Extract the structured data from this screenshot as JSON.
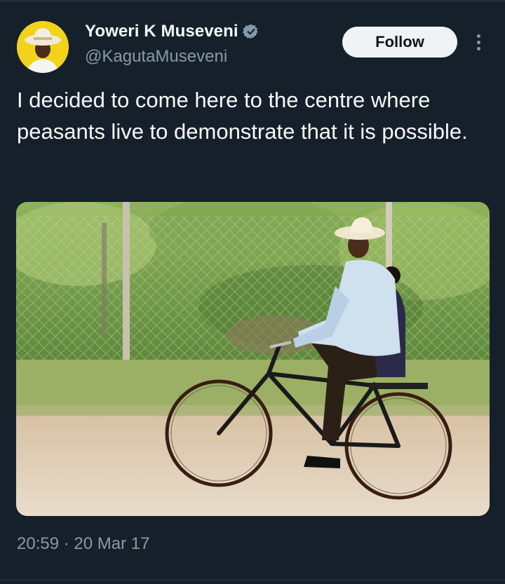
{
  "theme": {
    "background": "#15202b",
    "primary_text": "#f7f9f9",
    "secondary_text": "#8b98a5",
    "verified_badge": "#829aab",
    "follow_button_bg": "#eff3f4"
  },
  "author": {
    "display_name": "Yoweri K Museveni",
    "handle": "@KagutaMuseveni",
    "verified_icon": "verified-badge-icon",
    "avatar_icon": "profile-avatar"
  },
  "actions": {
    "follow_label": "Follow",
    "more_icon": "more-options-icon"
  },
  "tweet": {
    "text": "I decided to come here to the centre where peasants live to demonstrate that it is possible.",
    "media": "photo",
    "timestamp": "20:59 · 20 Mar 17"
  }
}
